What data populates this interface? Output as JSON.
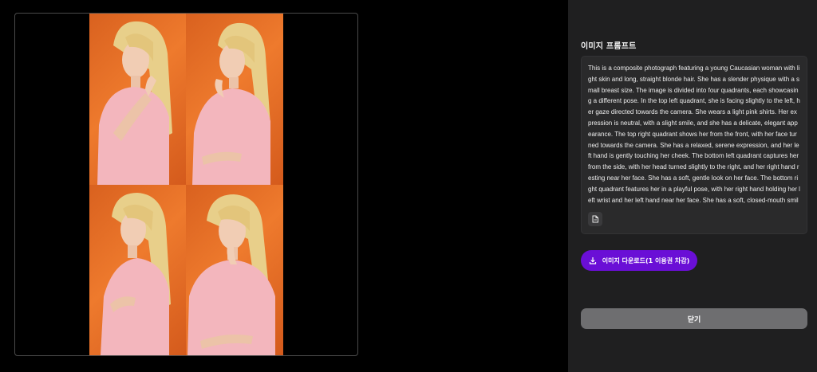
{
  "image_viewer": {
    "image_alt": "composite photograph preview"
  },
  "panel": {
    "title": "이미지 프롬프트",
    "prompt_text": "This is a composite photograph featuring a young Caucasian woman with light skin and long, straight blonde hair. She has a slender physique with a small breast size. The image is divided into four quadrants, each showcasing a different pose. In the top left quadrant, she is facing slightly to the left, her gaze directed towards the camera. She wears a light pink shirts. Her expression is neutral, with a slight smile, and she has a delicate, elegant appearance. The top right quadrant shows her from the front, with her face turned towards the camera. She has a relaxed, serene expression, and her left hand is gently touching her cheek. The bottom left quadrant captures her from the side, with her head turned slightly to the right, and her right hand resting near her face. She has a soft, gentle look on her face. The bottom right quadrant features her in a playful pose, with her right hand holding her left wrist and her left hand near her face. She has a soft, closed-mouth smile, and her overall demeanor is relaxed and serene. The background is a solid, deep",
    "download_label": "이미지 다운로드(1 이용권 차감)",
    "close_label": "닫기",
    "icons": {
      "copy": "copy-document-icon",
      "download": "download-icon"
    },
    "colors": {
      "accent": "#6a0fd6",
      "panel_bg": "#1f1f20",
      "close_bg": "#6e6e70"
    }
  }
}
